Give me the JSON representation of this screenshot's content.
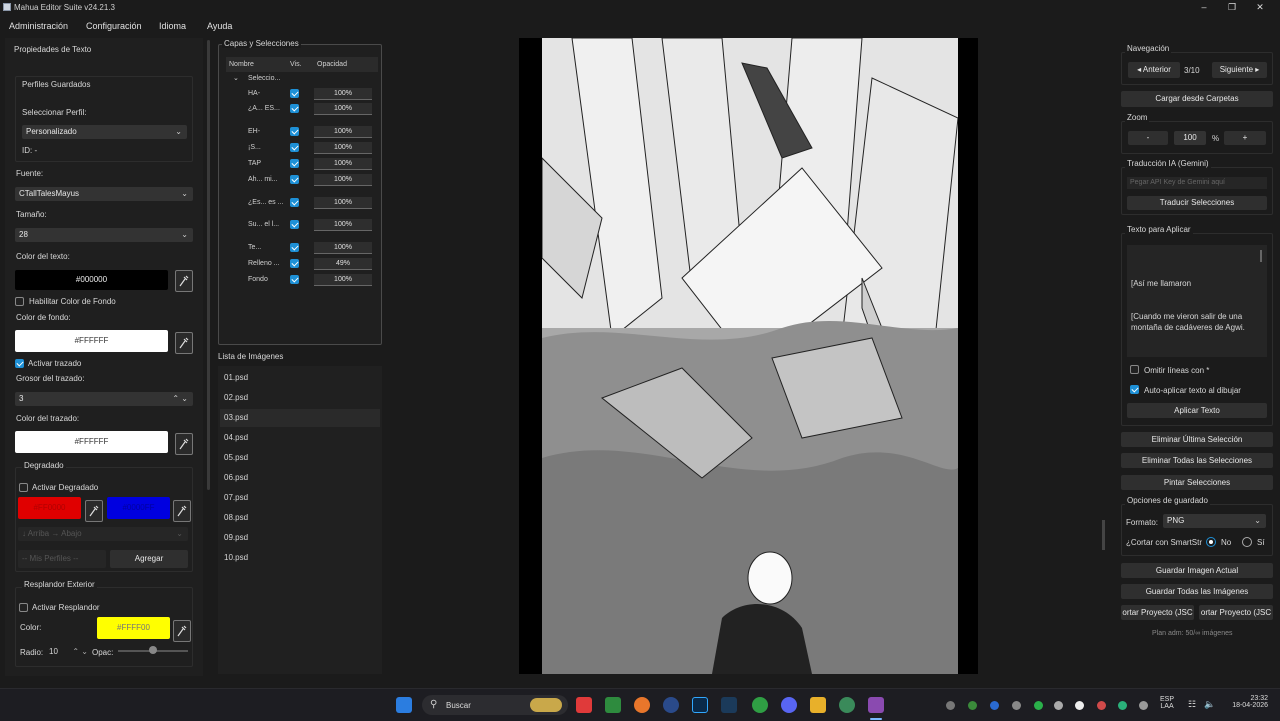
{
  "window": {
    "title": "Mahua Editor Suite v24.21.3"
  },
  "menu": {
    "items": [
      "Administración",
      "Configuración",
      "Idioma",
      "Ayuda"
    ]
  },
  "left": {
    "section_title": "Propiedades de Texto",
    "profiles": {
      "title": "Perfiles Guardados",
      "select_label": "Seleccionar Perfil:",
      "selected": "Personalizado",
      "id_label": "ID: -"
    },
    "font": {
      "label": "Fuente:",
      "value": "CTallTalesMayus"
    },
    "size": {
      "label": "Tamaño:",
      "value": "28"
    },
    "text_color": {
      "label": "Color del texto:",
      "hex": "#000000"
    },
    "bg_enable": "Habilitar Color de Fondo",
    "bg_color": {
      "label": "Color de fondo:",
      "hex": "#FFFFFF"
    },
    "stroke_enable": "Activar trazado",
    "stroke_width": {
      "label": "Grosor del trazado:",
      "value": "3"
    },
    "stroke_color": {
      "label": "Color del trazado:",
      "hex": "#FFFFFF"
    },
    "gradient": {
      "title": "Degradado",
      "enable": "Activar Degradado",
      "c1": "#FF0000",
      "c2": "#0000FF",
      "direction": "↓ Arriba → Abajo",
      "profiles": "-- Mis Perfiles --",
      "add": "Agregar"
    },
    "glow": {
      "title": "Resplandor Exterior",
      "enable": "Activar Resplandor",
      "color_label": "Color:",
      "hex": "#FFFF00",
      "radius_label": "Radio:",
      "radius": "10",
      "opacity_label": "Opac:"
    }
  },
  "layers": {
    "title": "Capas y Selecciones",
    "headers": {
      "name": "Nombre",
      "vis": "Vis.",
      "opacity": "Opacidad"
    },
    "group": "Seleccio...",
    "rows": [
      {
        "name": "HA-",
        "op": "100%"
      },
      {
        "name": "¿A... ES...",
        "op": "100%"
      },
      {
        "name": "EH-",
        "op": "100%"
      },
      {
        "name": "¡S...",
        "op": "100%"
      },
      {
        "name": "TAP",
        "op": "100%"
      },
      {
        "name": "Ah... mi...",
        "op": "100%"
      },
      {
        "name": "¿Es... es ...",
        "op": "100%"
      },
      {
        "name": "Su... el l...",
        "op": "100%"
      },
      {
        "name": "Te...",
        "op": "100%"
      },
      {
        "name": "Relleno ...",
        "op": "49%"
      },
      {
        "name": "Fondo",
        "op": "100%"
      }
    ]
  },
  "images": {
    "title": "Lista de Imágenes",
    "files": [
      "01.psd",
      "02.psd",
      "03.psd",
      "04.psd",
      "05.psd",
      "06.psd",
      "07.psd",
      "08.psd",
      "09.psd",
      "10.psd"
    ],
    "selected_index": 2
  },
  "right": {
    "nav": {
      "title": "Navegación",
      "prev": "◂ Anterior",
      "page": "3/10",
      "next": "Siguiente ▸"
    },
    "load": "Cargar desde Carpetas",
    "zoom": {
      "title": "Zoom",
      "minus": "-",
      "value": "100",
      "unit": "%",
      "plus": "+"
    },
    "ai": {
      "title": "Traducción IA (Gemini)",
      "placeholder": "Pegar API Key de Gemini aquí",
      "translate": "Traducir Selecciones"
    },
    "apply": {
      "title": "Texto para Aplicar",
      "line1": "[Así me llamaron",
      "line2": "[Cuando me vieron salir de una montaña de cadáveres de Agwi.",
      "skip_lines": "Omitir líneas con *",
      "auto_apply": "Auto-aplicar texto al dibujar",
      "apply_btn": "Aplicar Texto"
    },
    "del_last": "Eliminar Última Selección",
    "del_all": "Eliminar Todas las Selecciones",
    "paint": "Pintar Selecciones",
    "save_opts": {
      "title": "Opciones de guardado",
      "format_label": "Formato:",
      "format": "PNG",
      "smart_label": "¿Cortar con SmartStr",
      "no": "No",
      "yes": "Sí"
    },
    "save_current": "Guardar Imagen Actual",
    "save_all": "Guardar Todas las Imágenes",
    "export1": "ortar Proyecto (JSC",
    "export2": "ortar Proyecto (JSC",
    "plan": "Plan adm: 50/∞ imágenes"
  },
  "taskbar": {
    "search": "Buscar",
    "lang1": "ESP",
    "lang2": "LAA",
    "time": "23:32",
    "date": "18-04-2026"
  }
}
